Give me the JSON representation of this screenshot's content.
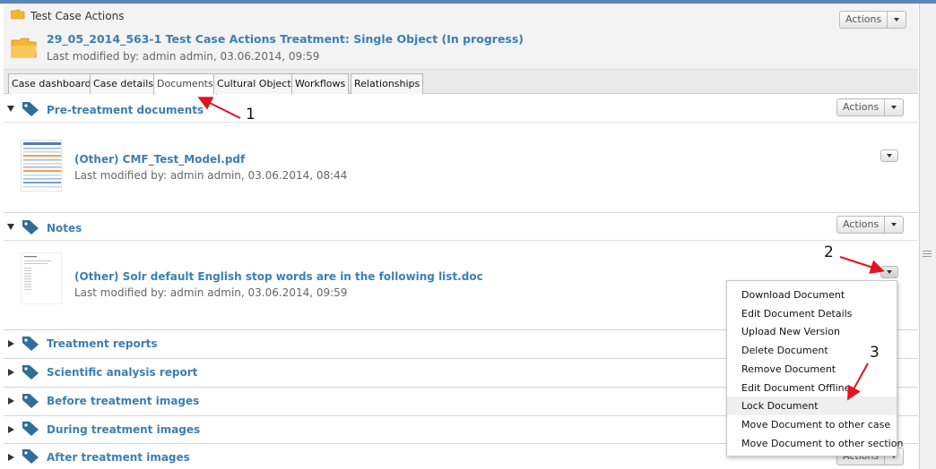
{
  "breadcrumb": {
    "label": "Test Case Actions"
  },
  "header": {
    "title": "29_05_2014_563-1 Test Case Actions Treatment: Single Object (In progress)",
    "modified": "Last modified by: admin admin, 03.06.2014, 09:59",
    "actions_label": "Actions"
  },
  "tabs": [
    {
      "label": "Case dashboard"
    },
    {
      "label": "Case details"
    },
    {
      "label": "Documents"
    },
    {
      "label": "Cultural Objects"
    },
    {
      "label": "Workflows"
    },
    {
      "label": "Relationships"
    }
  ],
  "sections": [
    {
      "title": "Pre-treatment documents",
      "actions_label": "Actions"
    },
    {
      "title": "Notes",
      "actions_label": "Actions"
    },
    {
      "title": "Treatment reports"
    },
    {
      "title": "Scientific analysis report"
    },
    {
      "title": "Before treatment images"
    },
    {
      "title": "During treatment images"
    },
    {
      "title": "After treatment images",
      "actions_label": "Actions"
    }
  ],
  "documents": [
    {
      "title": "(Other) CMF_Test_Model.pdf",
      "modified": "Last modified by: admin admin, 03.06.2014, 08:44"
    },
    {
      "title": "(Other) Solr default English stop words are in the following list.doc",
      "modified": "Last modified by: admin admin, 03.06.2014, 09:59"
    }
  ],
  "menu": {
    "items": [
      {
        "label": "Download Document"
      },
      {
        "label": "Edit Document Details"
      },
      {
        "label": "Upload New Version"
      },
      {
        "label": "Delete Document"
      },
      {
        "label": "Remove Document"
      },
      {
        "label": "Edit Document Offline"
      },
      {
        "label": "Lock Document"
      },
      {
        "label": "Move Document to other case"
      },
      {
        "label": "Move Document to other section"
      }
    ],
    "highlighted": "Lock Document"
  },
  "annotations": [
    "1",
    "2",
    "3"
  ],
  "colors": {
    "link": "#3c7fb1",
    "accent_bar": "#5b86b8",
    "arrow": "#e0141e",
    "folder": "#f5b630",
    "tag": "#2f6f97"
  }
}
